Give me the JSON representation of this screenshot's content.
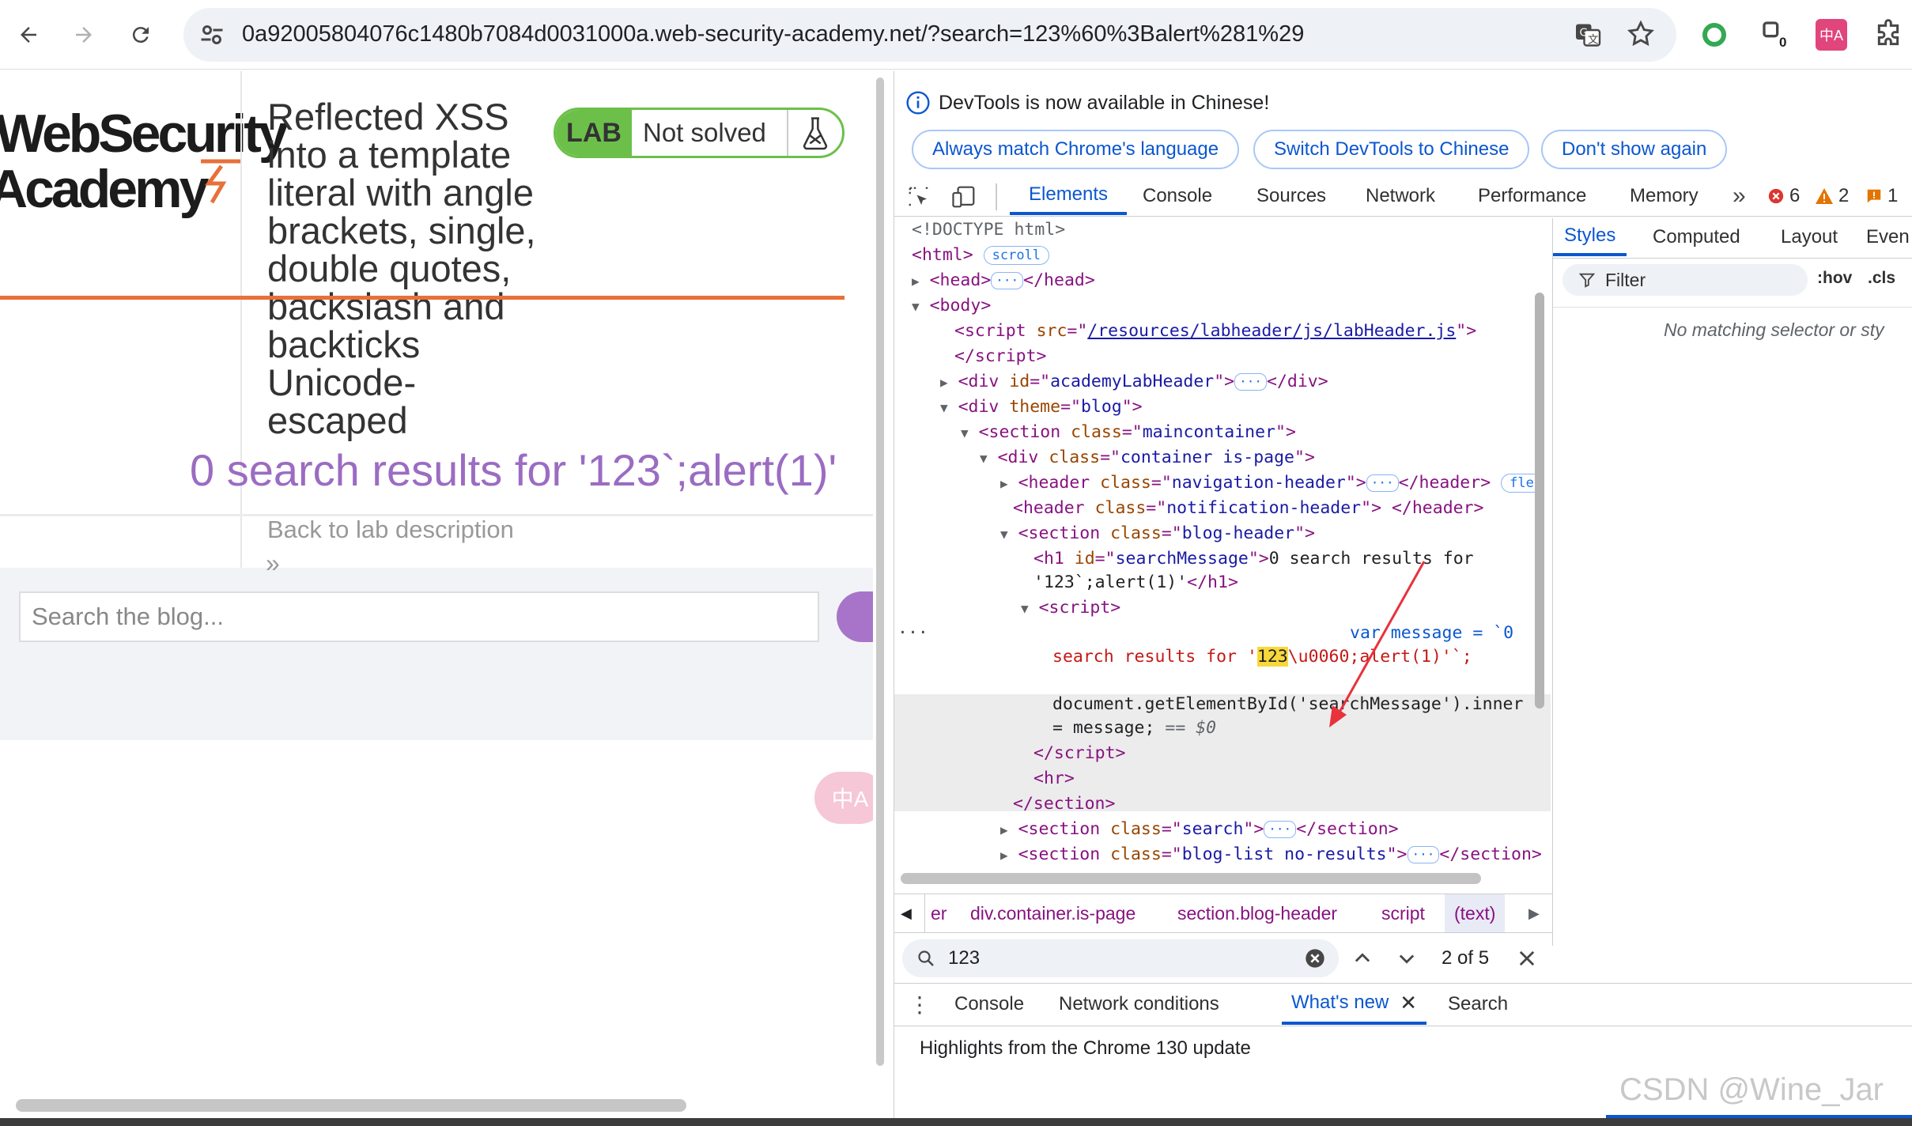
{
  "browser": {
    "url": "0a92005804076c1480b7084d0031000a.web-security-academy.net/?search=123%60%3Balert%281%29",
    "extension_badge_count": "0"
  },
  "page": {
    "logo_line1": "WebSecurity",
    "logo_line2": "Academy",
    "lab_title": "Reflected XSS into a template literal with angle brackets, single, double quotes, backslash and backticks Unicode-escaped",
    "lab_badge_label": "LAB",
    "lab_status": "Not solved",
    "search_message": "0 search results for '123`;alert(1)'",
    "back_link": "Back to lab description",
    "back_chevron": "»",
    "search_placeholder": "Search the blog...",
    "translate_fab": "中A"
  },
  "devtools": {
    "info_message": "DevTools is now available in Chinese!",
    "lang_buttons": [
      "Always match Chrome's language",
      "Switch DevTools to Chinese",
      "Don't show again"
    ],
    "tabs": [
      "Elements",
      "Console",
      "Sources",
      "Network",
      "Performance",
      "Memory"
    ],
    "more_tabs": "»",
    "errors": "6",
    "warnings": "2",
    "issues": "1",
    "styles_tabs": [
      "Styles",
      "Computed",
      "Layout",
      "Even"
    ],
    "filter_placeholder": "Filter",
    "hov": ":hov",
    "cls": ".cls",
    "no_matching": "No matching selector or sty",
    "breadcrumbs": [
      "er",
      "div.container.is-page",
      "section.blog-header",
      "script",
      "(text)"
    ],
    "find_query": "123",
    "find_count": "2 of 5",
    "drawer_tabs": [
      "Console",
      "Network conditions",
      "What's new",
      "Search"
    ],
    "whatsnew_text": "Highlights from the Chrome 130 update",
    "code": {
      "doctype": "<!DOCTYPE html>",
      "scroll_badge": "scroll",
      "flex_badge": "fle",
      "script_src": "/resources/labheader/js/labHeader.js",
      "lab_header_id": "academyLabHeader",
      "theme": "blog",
      "section_main": "maincontainer",
      "container_class": "container is-page",
      "nav_header": "navigation-header",
      "notif_header": "notification-header",
      "blog_header": "blog-header",
      "h1_id": "searchMessage",
      "h1_text_1": "0 search results for",
      "h1_text_2": "'123`;alert(1)'",
      "js_var": "var message = `0",
      "js_line2_pre": "search results for '",
      "js_highlight": "123",
      "js_line2_post": "\\u0060;alert(1)'`;",
      "js_line3": "document.getElementById('searchMessage').inner",
      "js_line4": "= message;",
      "dollar0": "== $0",
      "section_search": "search",
      "section_bloglist": "blog-list no-results"
    }
  },
  "watermark": "CSDN @Wine_Jar",
  "colors": {
    "accent": "#0b57d0",
    "lab_green": "#6cc04a",
    "academy_orange": "#e8703a",
    "search_purple": "#9b6cc2"
  }
}
